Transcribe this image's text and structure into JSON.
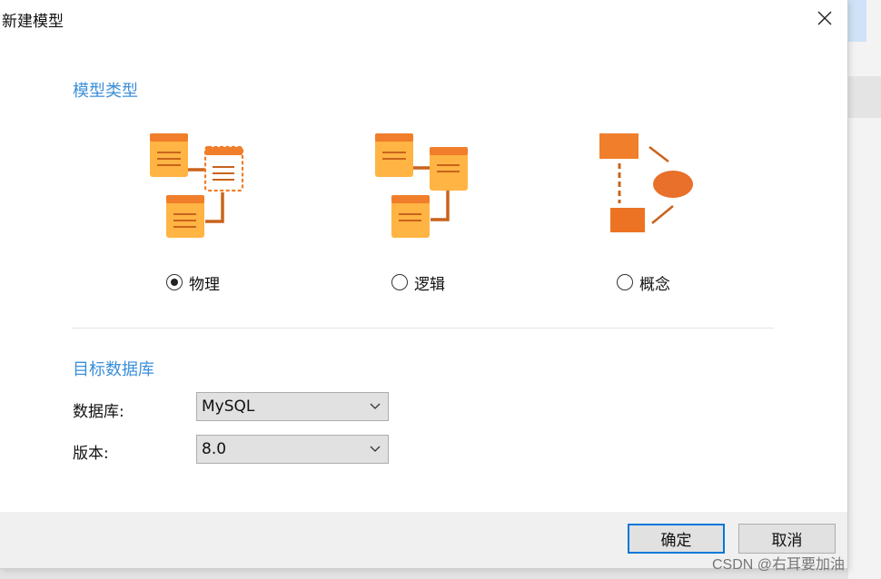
{
  "dialog": {
    "title": "新建模型",
    "close_icon": "close-icon"
  },
  "model_type": {
    "heading": "模型类型",
    "options": [
      {
        "label": "物理",
        "icon": "physical-model-icon",
        "selected": true
      },
      {
        "label": "逻辑",
        "icon": "logical-model-icon",
        "selected": false
      },
      {
        "label": "概念",
        "icon": "conceptual-model-icon",
        "selected": false
      }
    ]
  },
  "target_database": {
    "heading": "目标数据库",
    "database_label": "数据库:",
    "database_value": "MySQL",
    "version_label": "版本:",
    "version_value": "8.0"
  },
  "buttons": {
    "ok_label": "确定",
    "cancel_label": "取消"
  },
  "watermark": "CSDN @右耳要加油",
  "colors": {
    "accent": "#3b8fd9",
    "icon_orange": "#ffa726",
    "icon_dark_orange": "#e8702a",
    "focus_border": "#0078d7"
  }
}
